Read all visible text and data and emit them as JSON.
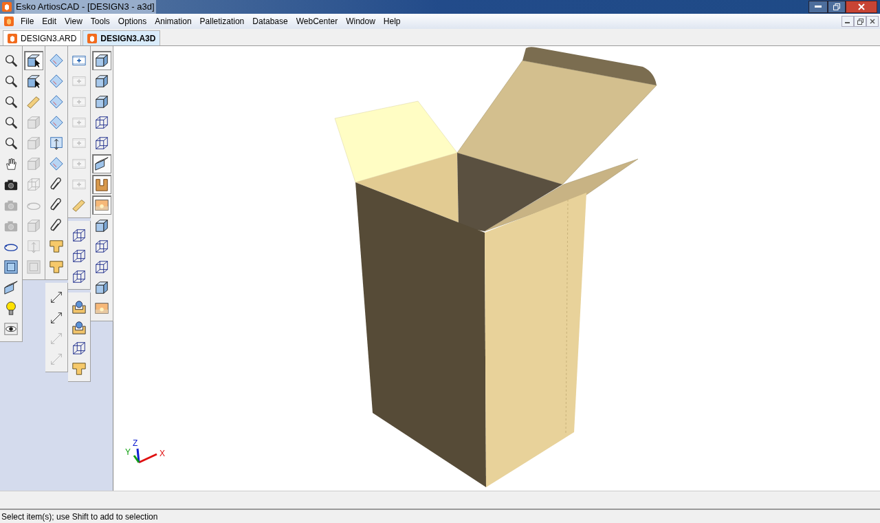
{
  "window": {
    "title": "Esko ArtiosCAD - [DESIGN3 - a3d]"
  },
  "menu": [
    "File",
    "Edit",
    "View",
    "Tools",
    "Options",
    "Animation",
    "Palletization",
    "Database",
    "WebCenter",
    "Window",
    "Help"
  ],
  "tabs": [
    {
      "label": "DESIGN3.ARD",
      "selected": false
    },
    {
      "label": "DESIGN3.A3D",
      "selected": true
    }
  ],
  "toolbars": [
    {
      "groups": [
        {
          "items": [
            {
              "kind": "magnifier",
              "disabled": false,
              "pressed": false
            },
            {
              "kind": "magnifier",
              "disabled": false,
              "pressed": false
            },
            {
              "kind": "magnifier",
              "disabled": false,
              "pressed": false
            },
            {
              "kind": "magnifier",
              "disabled": false,
              "pressed": false
            },
            {
              "kind": "magnifier",
              "disabled": false,
              "pressed": false
            },
            {
              "kind": "hand",
              "disabled": false,
              "pressed": false
            },
            {
              "kind": "camera",
              "disabled": false,
              "pressed": false
            },
            {
              "kind": "camera",
              "disabled": true,
              "pressed": false
            },
            {
              "kind": "camera",
              "disabled": true,
              "pressed": false
            },
            {
              "kind": "rotate",
              "disabled": false,
              "pressed": false
            },
            {
              "kind": "frame",
              "disabled": false,
              "pressed": false
            },
            {
              "kind": "prism",
              "disabled": false,
              "pressed": false
            },
            {
              "kind": "bulb",
              "disabled": false,
              "pressed": false
            },
            {
              "kind": "eye",
              "disabled": false,
              "pressed": false
            }
          ]
        }
      ]
    },
    {
      "groups": [
        {
          "items": [
            {
              "kind": "selector",
              "disabled": false,
              "pressed": true
            },
            {
              "kind": "selector",
              "disabled": false,
              "pressed": false
            },
            {
              "kind": "tape",
              "disabled": false,
              "pressed": false
            },
            {
              "kind": "cube",
              "disabled": true,
              "pressed": false
            },
            {
              "kind": "cube",
              "disabled": true,
              "pressed": false
            },
            {
              "kind": "cube",
              "disabled": true,
              "pressed": false
            },
            {
              "kind": "wireframe",
              "disabled": true,
              "pressed": false
            },
            {
              "kind": "rotate",
              "disabled": true,
              "pressed": false
            },
            {
              "kind": "cube",
              "disabled": true,
              "pressed": false
            },
            {
              "kind": "move",
              "disabled": true,
              "pressed": false
            },
            {
              "kind": "frame",
              "disabled": true,
              "pressed": false
            }
          ]
        }
      ]
    },
    {
      "groups": [
        {
          "items": [
            {
              "kind": "sheet",
              "disabled": false,
              "pressed": false
            },
            {
              "kind": "sheet",
              "disabled": false,
              "pressed": false
            },
            {
              "kind": "sheet",
              "disabled": false,
              "pressed": false
            },
            {
              "kind": "sheet",
              "disabled": false,
              "pressed": false
            },
            {
              "kind": "move",
              "disabled": false,
              "pressed": false
            },
            {
              "kind": "sheet",
              "disabled": false,
              "pressed": false
            },
            {
              "kind": "clip",
              "disabled": false,
              "pressed": false
            },
            {
              "kind": "clip",
              "disabled": false,
              "pressed": false
            },
            {
              "kind": "clip",
              "disabled": false,
              "pressed": false
            },
            {
              "kind": "shape",
              "disabled": false,
              "pressed": false
            },
            {
              "kind": "shape",
              "disabled": false,
              "pressed": false
            }
          ]
        },
        {
          "items": [
            {
              "kind": "dimension",
              "disabled": false,
              "pressed": false
            },
            {
              "kind": "dimension",
              "disabled": false,
              "pressed": false
            },
            {
              "kind": "dimension",
              "disabled": true,
              "pressed": false
            },
            {
              "kind": "dimension",
              "disabled": true,
              "pressed": false
            }
          ]
        }
      ]
    },
    {
      "groups": [
        {
          "items": [
            {
              "kind": "film",
              "disabled": false,
              "pressed": false
            },
            {
              "kind": "film",
              "disabled": true,
              "pressed": false
            },
            {
              "kind": "film",
              "disabled": true,
              "pressed": false
            },
            {
              "kind": "film",
              "disabled": true,
              "pressed": false
            },
            {
              "kind": "film",
              "disabled": true,
              "pressed": false
            },
            {
              "kind": "film",
              "disabled": true,
              "pressed": false
            },
            {
              "kind": "film",
              "disabled": true,
              "pressed": false
            },
            {
              "kind": "tape",
              "disabled": false,
              "pressed": false
            }
          ]
        },
        {
          "items": [
            {
              "kind": "wireframe",
              "disabled": false,
              "pressed": false
            },
            {
              "kind": "wireframe",
              "disabled": false,
              "pressed": false
            },
            {
              "kind": "wireframe",
              "disabled": false,
              "pressed": false
            }
          ]
        },
        {
          "items": [
            {
              "kind": "tray",
              "disabled": false,
              "pressed": false
            },
            {
              "kind": "tray",
              "disabled": false,
              "pressed": false
            },
            {
              "kind": "wireframe",
              "disabled": false,
              "pressed": false
            },
            {
              "kind": "shape",
              "disabled": false,
              "pressed": false
            }
          ]
        }
      ]
    },
    {
      "groups": [
        {
          "items": [
            {
              "kind": "cube",
              "disabled": false,
              "pressed": true
            },
            {
              "kind": "cube",
              "disabled": false,
              "pressed": false
            },
            {
              "kind": "cube",
              "disabled": false,
              "pressed": false
            },
            {
              "kind": "wireframe",
              "disabled": false,
              "pressed": false
            },
            {
              "kind": "wireframe",
              "disabled": false,
              "pressed": false
            },
            {
              "kind": "prism",
              "disabled": false,
              "pressed": true
            },
            {
              "kind": "channel",
              "disabled": false,
              "pressed": true
            },
            {
              "kind": "photo",
              "disabled": false,
              "pressed": true
            },
            {
              "kind": "cube",
              "disabled": false,
              "pressed": false
            },
            {
              "kind": "wireframe",
              "disabled": false,
              "pressed": false
            },
            {
              "kind": "wireframe",
              "disabled": false,
              "pressed": false
            },
            {
              "kind": "cube",
              "disabled": false,
              "pressed": false
            },
            {
              "kind": "photo",
              "disabled": false,
              "pressed": false
            }
          ]
        }
      ]
    }
  ],
  "axes": {
    "x": "X",
    "y": "Y",
    "z": "Z"
  },
  "status_bar": "Select item(s); use Shift to add to selection"
}
